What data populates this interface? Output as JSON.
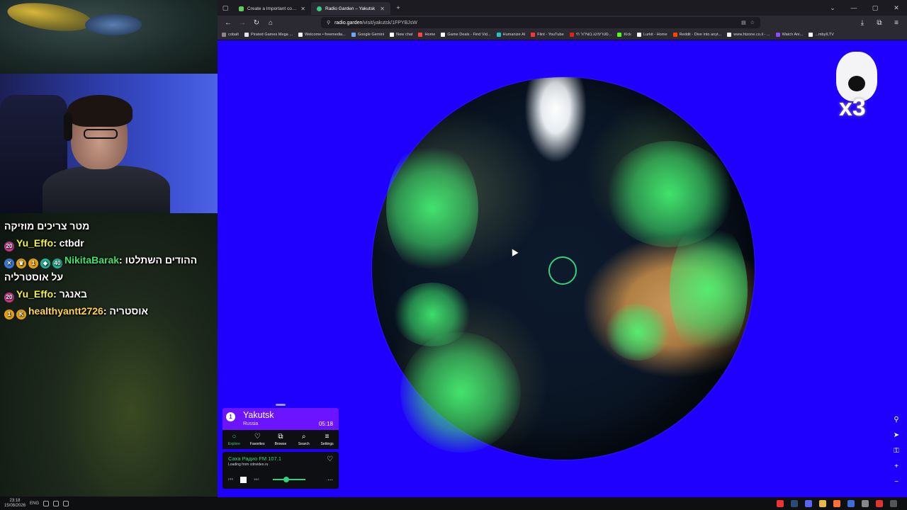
{
  "stream": {
    "chat": [
      {
        "user": "",
        "text": "מטר צריכים מוזיקה"
      },
      {
        "user": "Yu_Effo",
        "text": ": ctbdr",
        "badge": "20"
      },
      {
        "user": "NikitaBarak",
        "text": ": ההודים השתלטו",
        "badge": "40",
        "extra_badges": [
          "1"
        ]
      },
      {
        "user": "",
        "text": "על אוסטרליה"
      },
      {
        "user": "Yu_Effo",
        "text": ": באנגר",
        "badge": "20"
      },
      {
        "user": "healthyantt2726",
        "text": ": אוסטריה",
        "badge": "1"
      }
    ],
    "taskbar": {
      "time": "23:18",
      "date": "15/08/2026",
      "lang": "ENG"
    }
  },
  "browser": {
    "tabs": [
      {
        "title": "Create a Important countries T...",
        "active": false
      },
      {
        "title": "Radio Garden – Yakutsk",
        "active": true
      }
    ],
    "new_tab": "+",
    "url": {
      "host": "radio.garden",
      "path": "/visit/yakutsk/1FPYBJsW"
    },
    "bookmarks": [
      {
        "label": "cobalt",
        "color": "#888888"
      },
      {
        "label": "Pirated Games Mega ...",
        "color": "#e5e5e5"
      },
      {
        "label": "Welcome • freemedia...",
        "color": "#f5f5f5"
      },
      {
        "label": "Google Gemini",
        "color": "#6aa7ff"
      },
      {
        "label": "New chat",
        "color": "#ffffff"
      },
      {
        "label": "Home",
        "color": "#ff4444"
      },
      {
        "label": "Game Deals - Find Vid...",
        "color": "#ffffff"
      },
      {
        "label": "Humanize AI",
        "color": "#22c4c4"
      },
      {
        "label": "Flint - YouTube",
        "color": "#ff3333"
      },
      {
        "label": "סטרימינג בשידור חי...",
        "color": "#dd2222"
      },
      {
        "label": "Kick",
        "color": "#53fc18"
      },
      {
        "label": "Lurkit - Home",
        "color": "#ffffff"
      },
      {
        "label": "Reddit - Dive into anyt...",
        "color": "#ff4500"
      },
      {
        "label": "www.htzone.co.il - ...",
        "color": "#ffffff"
      },
      {
        "label": "Watch Ani...",
        "color": "#8a4cff"
      },
      {
        "label": "...mbyILTV",
        "color": "#ffffff"
      }
    ]
  },
  "radio": {
    "station_number": "1",
    "city": "Yakutsk",
    "country": "Russia",
    "time": "05:18",
    "tabs": [
      {
        "label": "Explore",
        "icon": "○",
        "active": true
      },
      {
        "label": "Favorites",
        "icon": "♡",
        "active": false
      },
      {
        "label": "Browse",
        "icon": "⧉",
        "active": false
      },
      {
        "label": "Search",
        "icon": "⌕",
        "active": false
      },
      {
        "label": "Settings",
        "icon": "≡",
        "active": false
      }
    ],
    "now_playing": {
      "station": "Саха Радио FM 107.1",
      "status": "Loading from cdnvideo.ru"
    },
    "volume": 0.4,
    "mascot_label": "x3"
  }
}
